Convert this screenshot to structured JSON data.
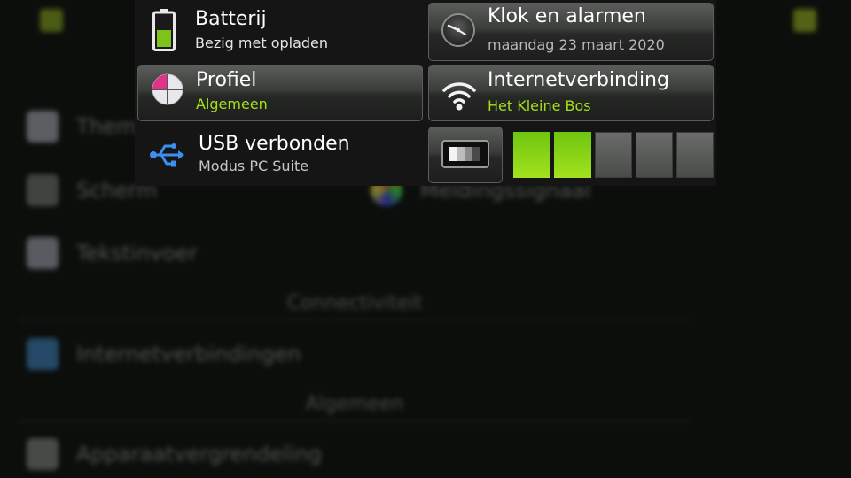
{
  "background": {
    "items": [
      {
        "label": "Thema",
        "icon": "theme-icon"
      },
      {
        "label": "Scherm",
        "icon": "display-icon"
      },
      {
        "label": "Tekstinvoer",
        "icon": "keyboard-icon"
      },
      {
        "label": "Internetverbindingen",
        "icon": "globe-icon"
      },
      {
        "label": "Apparaatvergrendeling",
        "icon": "lock-icon"
      }
    ],
    "right_item": {
      "label": "Meldingssignaal",
      "icon": "led-icon"
    },
    "sections": [
      "Connectiviteit",
      "Algemeen"
    ]
  },
  "menu": {
    "battery": {
      "title": "Batterij",
      "status": "Bezig met opladen",
      "icon": "battery-icon"
    },
    "clock": {
      "title": "Klok en alarmen",
      "date": "maandag 23 maart 2020",
      "icon": "clock-icon"
    },
    "profile": {
      "title": "Profiel",
      "value": "Algemeen",
      "icon": "profile-icon"
    },
    "internet": {
      "title": "Internetverbinding",
      "network": "Het Kleine Bos",
      "icon": "wifi-icon"
    },
    "usb": {
      "title": "USB verbonden",
      "mode": "Modus PC Suite",
      "icon": "usb-icon"
    },
    "brightness": {
      "level": 2,
      "max": 5,
      "icon": "brightness-icon"
    }
  },
  "colors": {
    "accent_green": "#a6e019",
    "usb_blue": "#3b8ff0",
    "profile_pink": "#e0338c"
  }
}
